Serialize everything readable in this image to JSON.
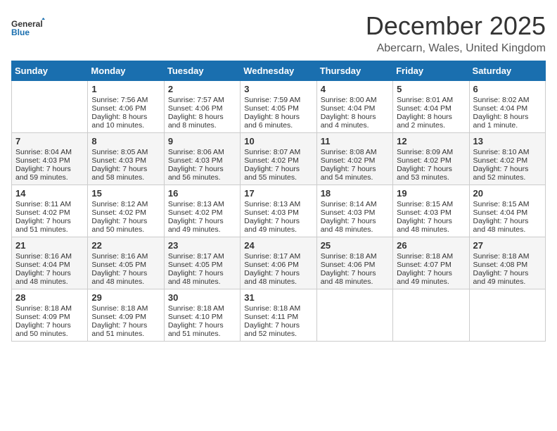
{
  "logo": {
    "general": "General",
    "blue": "Blue"
  },
  "header": {
    "month": "December 2025",
    "location": "Abercarn, Wales, United Kingdom"
  },
  "weekdays": [
    "Sunday",
    "Monday",
    "Tuesday",
    "Wednesday",
    "Thursday",
    "Friday",
    "Saturday"
  ],
  "weeks": [
    [
      {
        "day": "",
        "sunrise": "",
        "sunset": "",
        "daylight": ""
      },
      {
        "day": "1",
        "sunrise": "Sunrise: 7:56 AM",
        "sunset": "Sunset: 4:06 PM",
        "daylight": "Daylight: 8 hours and 10 minutes."
      },
      {
        "day": "2",
        "sunrise": "Sunrise: 7:57 AM",
        "sunset": "Sunset: 4:06 PM",
        "daylight": "Daylight: 8 hours and 8 minutes."
      },
      {
        "day": "3",
        "sunrise": "Sunrise: 7:59 AM",
        "sunset": "Sunset: 4:05 PM",
        "daylight": "Daylight: 8 hours and 6 minutes."
      },
      {
        "day": "4",
        "sunrise": "Sunrise: 8:00 AM",
        "sunset": "Sunset: 4:04 PM",
        "daylight": "Daylight: 8 hours and 4 minutes."
      },
      {
        "day": "5",
        "sunrise": "Sunrise: 8:01 AM",
        "sunset": "Sunset: 4:04 PM",
        "daylight": "Daylight: 8 hours and 2 minutes."
      },
      {
        "day": "6",
        "sunrise": "Sunrise: 8:02 AM",
        "sunset": "Sunset: 4:04 PM",
        "daylight": "Daylight: 8 hours and 1 minute."
      }
    ],
    [
      {
        "day": "7",
        "sunrise": "Sunrise: 8:04 AM",
        "sunset": "Sunset: 4:03 PM",
        "daylight": "Daylight: 7 hours and 59 minutes."
      },
      {
        "day": "8",
        "sunrise": "Sunrise: 8:05 AM",
        "sunset": "Sunset: 4:03 PM",
        "daylight": "Daylight: 7 hours and 58 minutes."
      },
      {
        "day": "9",
        "sunrise": "Sunrise: 8:06 AM",
        "sunset": "Sunset: 4:03 PM",
        "daylight": "Daylight: 7 hours and 56 minutes."
      },
      {
        "day": "10",
        "sunrise": "Sunrise: 8:07 AM",
        "sunset": "Sunset: 4:02 PM",
        "daylight": "Daylight: 7 hours and 55 minutes."
      },
      {
        "day": "11",
        "sunrise": "Sunrise: 8:08 AM",
        "sunset": "Sunset: 4:02 PM",
        "daylight": "Daylight: 7 hours and 54 minutes."
      },
      {
        "day": "12",
        "sunrise": "Sunrise: 8:09 AM",
        "sunset": "Sunset: 4:02 PM",
        "daylight": "Daylight: 7 hours and 53 minutes."
      },
      {
        "day": "13",
        "sunrise": "Sunrise: 8:10 AM",
        "sunset": "Sunset: 4:02 PM",
        "daylight": "Daylight: 7 hours and 52 minutes."
      }
    ],
    [
      {
        "day": "14",
        "sunrise": "Sunrise: 8:11 AM",
        "sunset": "Sunset: 4:02 PM",
        "daylight": "Daylight: 7 hours and 51 minutes."
      },
      {
        "day": "15",
        "sunrise": "Sunrise: 8:12 AM",
        "sunset": "Sunset: 4:02 PM",
        "daylight": "Daylight: 7 hours and 50 minutes."
      },
      {
        "day": "16",
        "sunrise": "Sunrise: 8:13 AM",
        "sunset": "Sunset: 4:02 PM",
        "daylight": "Daylight: 7 hours and 49 minutes."
      },
      {
        "day": "17",
        "sunrise": "Sunrise: 8:13 AM",
        "sunset": "Sunset: 4:03 PM",
        "daylight": "Daylight: 7 hours and 49 minutes."
      },
      {
        "day": "18",
        "sunrise": "Sunrise: 8:14 AM",
        "sunset": "Sunset: 4:03 PM",
        "daylight": "Daylight: 7 hours and 48 minutes."
      },
      {
        "day": "19",
        "sunrise": "Sunrise: 8:15 AM",
        "sunset": "Sunset: 4:03 PM",
        "daylight": "Daylight: 7 hours and 48 minutes."
      },
      {
        "day": "20",
        "sunrise": "Sunrise: 8:15 AM",
        "sunset": "Sunset: 4:04 PM",
        "daylight": "Daylight: 7 hours and 48 minutes."
      }
    ],
    [
      {
        "day": "21",
        "sunrise": "Sunrise: 8:16 AM",
        "sunset": "Sunset: 4:04 PM",
        "daylight": "Daylight: 7 hours and 48 minutes."
      },
      {
        "day": "22",
        "sunrise": "Sunrise: 8:16 AM",
        "sunset": "Sunset: 4:05 PM",
        "daylight": "Daylight: 7 hours and 48 minutes."
      },
      {
        "day": "23",
        "sunrise": "Sunrise: 8:17 AM",
        "sunset": "Sunset: 4:05 PM",
        "daylight": "Daylight: 7 hours and 48 minutes."
      },
      {
        "day": "24",
        "sunrise": "Sunrise: 8:17 AM",
        "sunset": "Sunset: 4:06 PM",
        "daylight": "Daylight: 7 hours and 48 minutes."
      },
      {
        "day": "25",
        "sunrise": "Sunrise: 8:18 AM",
        "sunset": "Sunset: 4:06 PM",
        "daylight": "Daylight: 7 hours and 48 minutes."
      },
      {
        "day": "26",
        "sunrise": "Sunrise: 8:18 AM",
        "sunset": "Sunset: 4:07 PM",
        "daylight": "Daylight: 7 hours and 49 minutes."
      },
      {
        "day": "27",
        "sunrise": "Sunrise: 8:18 AM",
        "sunset": "Sunset: 4:08 PM",
        "daylight": "Daylight: 7 hours and 49 minutes."
      }
    ],
    [
      {
        "day": "28",
        "sunrise": "Sunrise: 8:18 AM",
        "sunset": "Sunset: 4:09 PM",
        "daylight": "Daylight: 7 hours and 50 minutes."
      },
      {
        "day": "29",
        "sunrise": "Sunrise: 8:18 AM",
        "sunset": "Sunset: 4:09 PM",
        "daylight": "Daylight: 7 hours and 51 minutes."
      },
      {
        "day": "30",
        "sunrise": "Sunrise: 8:18 AM",
        "sunset": "Sunset: 4:10 PM",
        "daylight": "Daylight: 7 hours and 51 minutes."
      },
      {
        "day": "31",
        "sunrise": "Sunrise: 8:18 AM",
        "sunset": "Sunset: 4:11 PM",
        "daylight": "Daylight: 7 hours and 52 minutes."
      },
      {
        "day": "",
        "sunrise": "",
        "sunset": "",
        "daylight": ""
      },
      {
        "day": "",
        "sunrise": "",
        "sunset": "",
        "daylight": ""
      },
      {
        "day": "",
        "sunrise": "",
        "sunset": "",
        "daylight": ""
      }
    ]
  ]
}
